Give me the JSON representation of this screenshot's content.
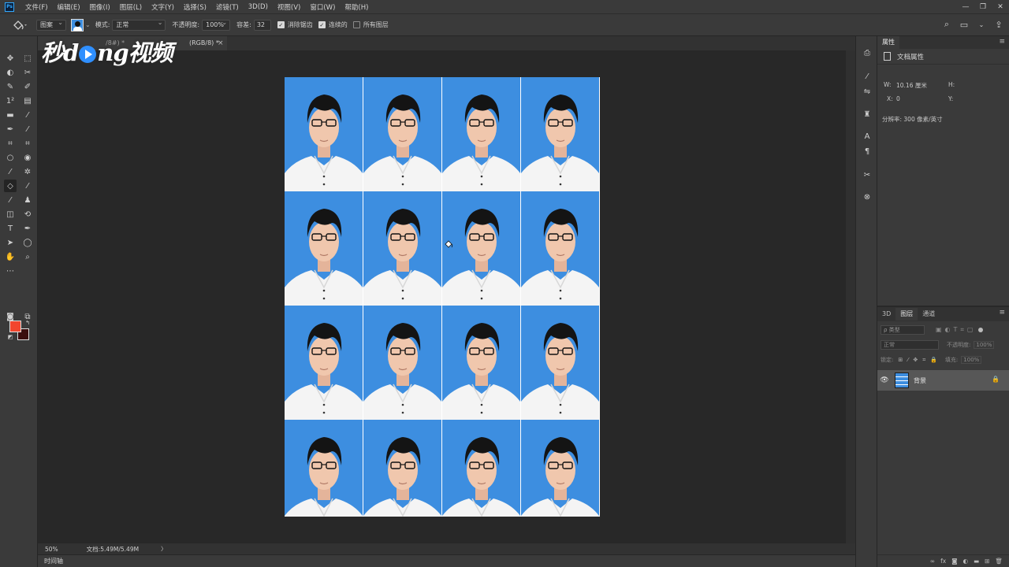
{
  "menu": {
    "logo": "Ps",
    "items": [
      "文件(F)",
      "编辑(E)",
      "图像(I)",
      "图层(L)",
      "文字(Y)",
      "选择(S)",
      "滤镜(T)",
      "3D(D)",
      "视图(V)",
      "窗口(W)",
      "帮助(H)"
    ]
  },
  "window_controls": {
    "minimize": "—",
    "restore": "❐",
    "close": "✕"
  },
  "options": {
    "source_value": "图案",
    "mode_label": "模式:",
    "mode_value": "正常",
    "opacity_label": "不透明度:",
    "opacity_value": "100%",
    "tolerance_label": "容差:",
    "tolerance_value": "32",
    "antialias_label": "消除锯齿",
    "antialias_checked": true,
    "contiguous_label": "连续的",
    "contiguous_checked": true,
    "all_layers_label": "所有图层",
    "all_layers_checked": false
  },
  "document_tab": {
    "title": "(RGB/8) *",
    "partial_text": "/8#) *"
  },
  "watermark": {
    "text_left": "秒d",
    "text_right": "ng视频"
  },
  "colors": {
    "foreground": "#f2462e",
    "background": "#3b0e0e",
    "photo_bg": "#3d8ee0"
  },
  "document": {
    "rows": 4,
    "cols": 4
  },
  "status": {
    "zoom": "50%",
    "doc_size": "文档:5.49M/5.49M",
    "arrow": "〉"
  },
  "timeline": {
    "label": "时间轴"
  },
  "properties": {
    "tab_label": "属性",
    "title": "文档属性",
    "w_label": "W:",
    "w_value": "10.16 厘米",
    "h_label": "H:",
    "x_label": "X:",
    "x_value": "0",
    "y_label": "Y:",
    "resolution": "分辨率: 300 像素/英寸"
  },
  "layers_panel": {
    "tabs": [
      "3D",
      "图层",
      "通道"
    ],
    "kind_placeholder": "ρ 类型",
    "blend_mode": "正常",
    "opacity_label": "不透明度:",
    "opacity_value": "100%",
    "lock_label": "锁定:",
    "fill_label": "填充:",
    "fill_value": "100%",
    "layer_name": "背景"
  }
}
